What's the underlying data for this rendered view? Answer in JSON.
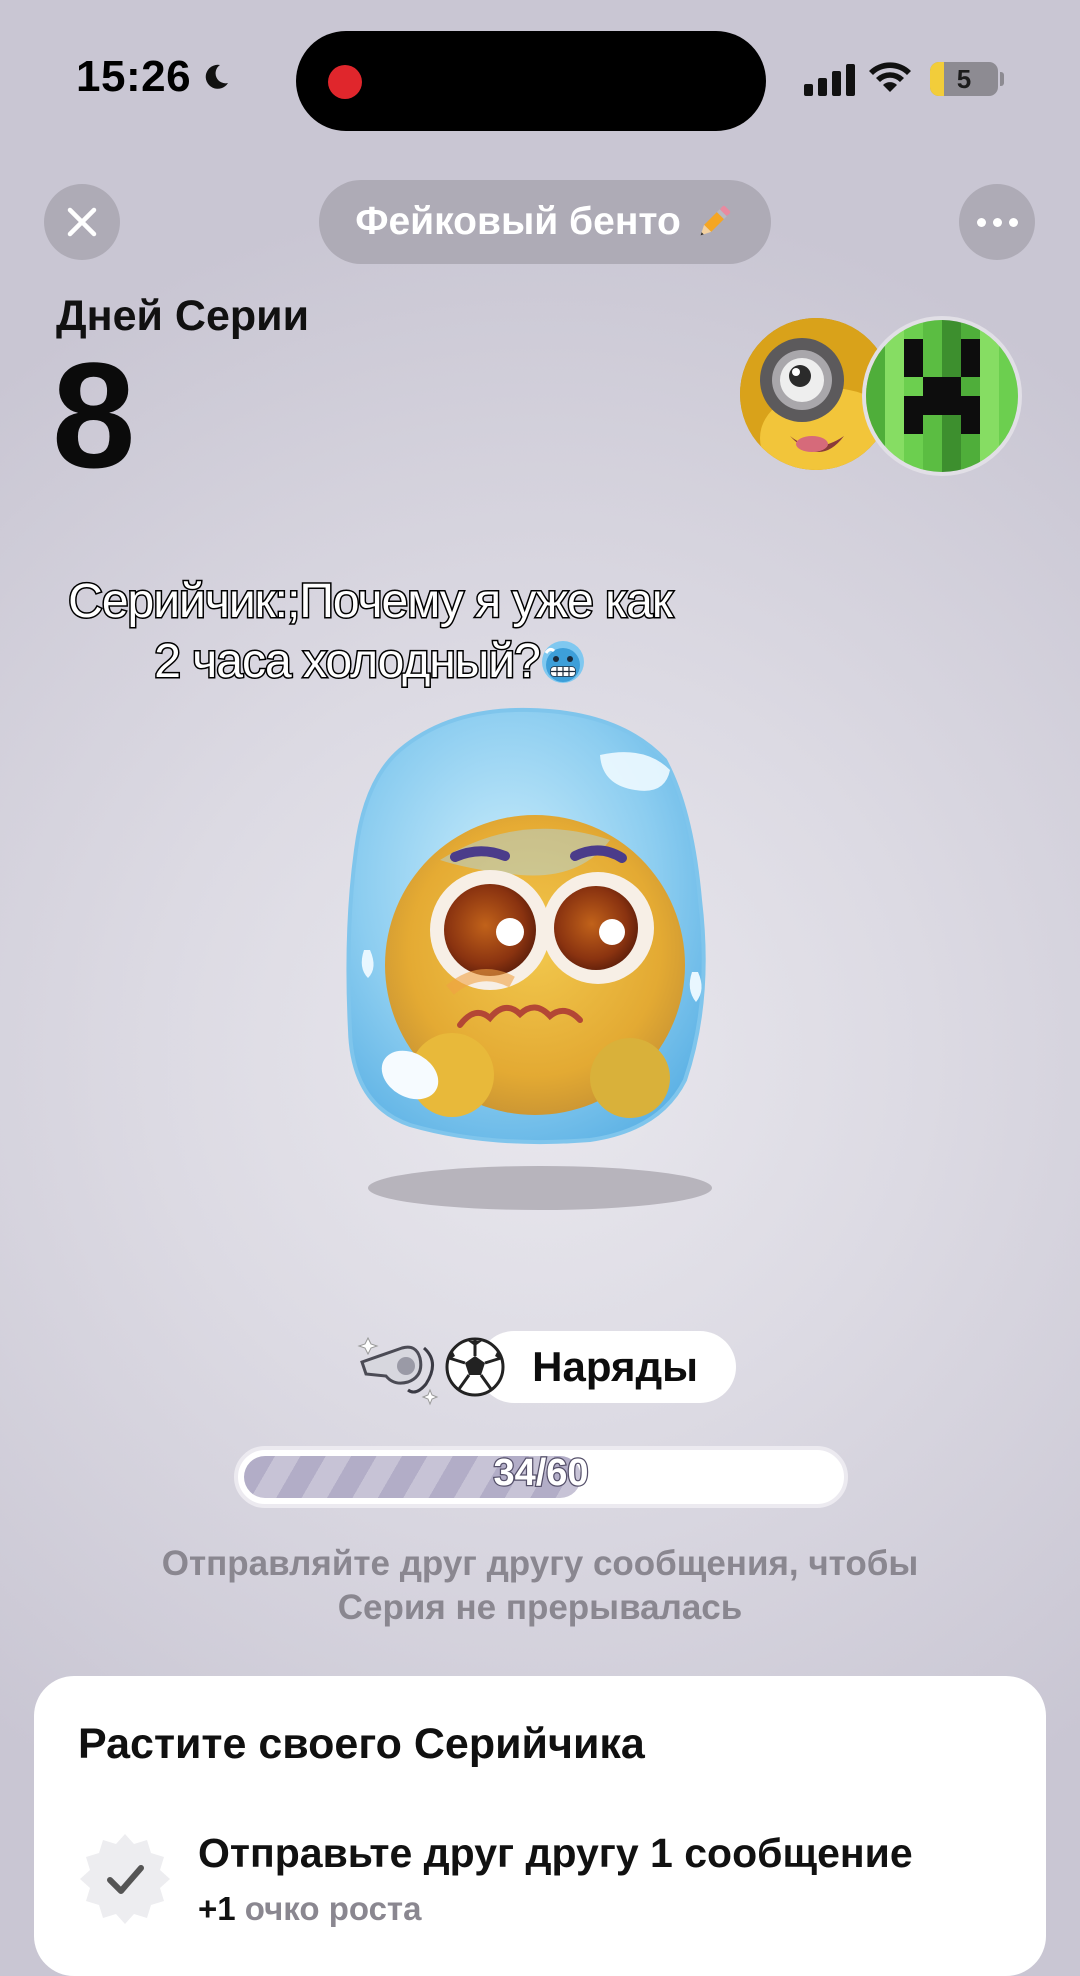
{
  "status_bar": {
    "time": "15:26",
    "battery": "5",
    "icons": [
      "moon-icon",
      "signal-icon",
      "wifi-icon",
      "battery-icon"
    ],
    "recording_color": "#e0262c"
  },
  "header": {
    "title": "Фейковый бенто",
    "title_icon": "pencil-icon",
    "close_icon": "close-icon",
    "more_icon": "more-icon"
  },
  "streak": {
    "label": "Дней Серии",
    "days": "8"
  },
  "caption": {
    "line1": "Серийчик:;Почему я уже как",
    "line2": "2 часа холодный?",
    "emoji": "cold-face-emoji"
  },
  "outfits": {
    "label": "Наряды",
    "icons": [
      "whistle-icon",
      "soccer-ball-icon"
    ]
  },
  "progress": {
    "text": "34/60",
    "current": 34,
    "total": 60,
    "fraction": 0.567
  },
  "hint": {
    "line1": "Отправляйте друг другу сообщения, чтобы",
    "line2": "Серия не прерывалась"
  },
  "card": {
    "title": "Растите своего Серийчика",
    "task": {
      "title": "Отправьте друг другу 1 сообщение",
      "reward_prefix": "+1",
      "reward_text": "очко роста",
      "icon": "check-badge-icon"
    }
  },
  "colors": {
    "background": "#d9d7e0",
    "pill": "#aeabb6",
    "progress_fill": "#b8b3cc",
    "muted_text": "#8a8790"
  }
}
